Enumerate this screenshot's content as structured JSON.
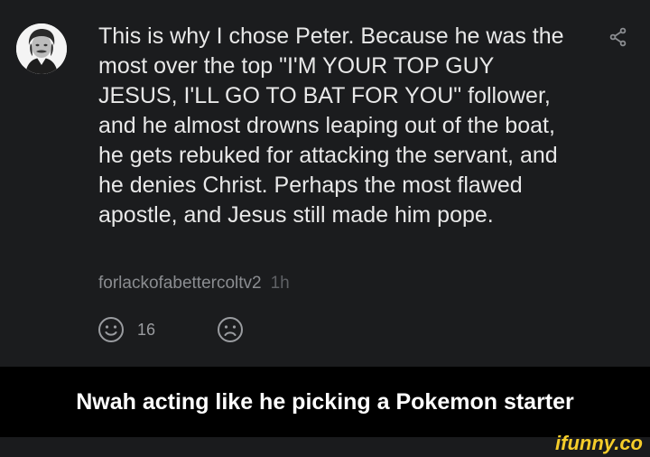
{
  "comment": {
    "text": "This is why I chose Peter. Because he was the most over the top \"I'M YOUR TOP GUY JESUS, I'LL GO TO BAT FOR YOU\" follower, and he almost drowns leaping out of the boat, he gets rebuked for attacking the servant, and he denies Christ. Perhaps the most flawed apostle, and Jesus still made him pope.",
    "username": "forlackofabettercoltv2",
    "time": "1h",
    "likes": "16"
  },
  "icons": {
    "avatar": "avatar-photo",
    "share": "share-icon",
    "like": "smile-face-icon",
    "dislike": "frown-face-icon"
  },
  "caption": "Nwah acting like he picking a Pokemon starter",
  "watermark": "ifunny.co",
  "colors": {
    "background": "#1b1c1e",
    "caption_bar": "#000000",
    "text": "#e8e8e8",
    "meta": "#8b8d91",
    "watermark": "#f5cd2a"
  }
}
